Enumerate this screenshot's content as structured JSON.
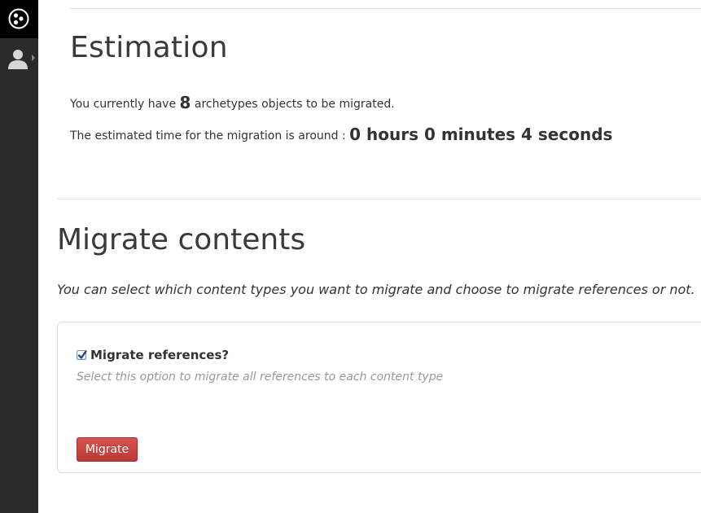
{
  "colors": {
    "sidebar_bg": "#2b2b2b",
    "logo_bg": "#000000",
    "primary_danger": "#c9302c",
    "text": "#333333",
    "muted": "#999999"
  },
  "sidebar": {
    "logo_icon": "plone-logo-icon",
    "user_icon": "user-icon",
    "caret_icon": "caret-right-icon"
  },
  "estimation": {
    "title": "Estimation",
    "count_prefix": "You currently have",
    "count_value": "8",
    "count_suffix": "archetypes objects to be migrated.",
    "time_prefix": "The estimated time for the migration is around :",
    "time_value": "0 hours 0 minutes 4 seconds"
  },
  "migrate": {
    "title": "Migrate contents",
    "lead": "You can select which content types you want to migrate and choose to migrate references or not.",
    "references_label": "Migrate references?",
    "references_checked": true,
    "references_help": "Select this option to migrate all references to each content type",
    "button_label": "Migrate"
  }
}
